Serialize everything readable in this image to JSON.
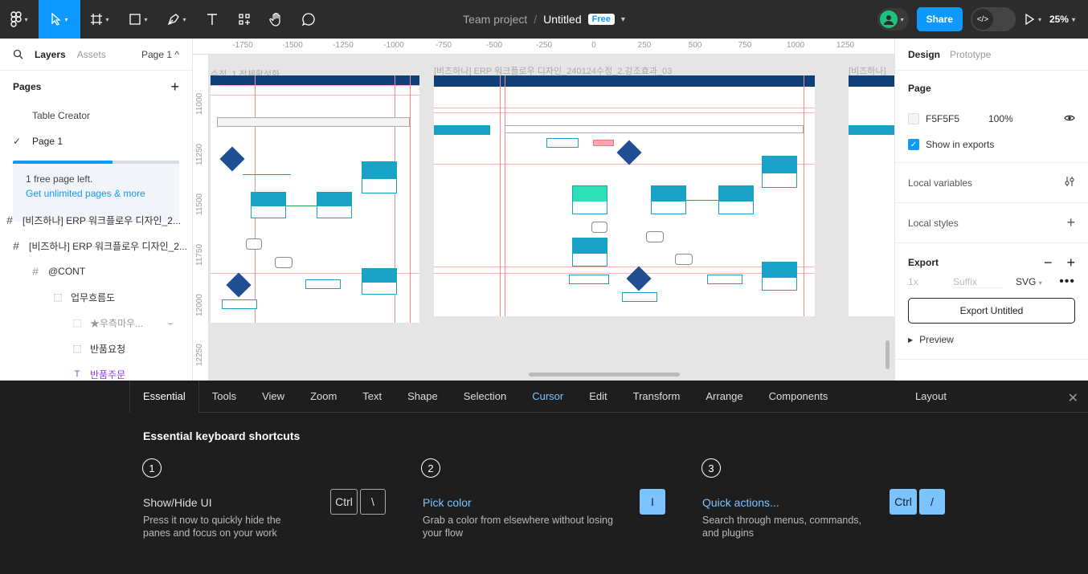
{
  "topbar": {
    "team": "Team project",
    "separator": "/",
    "file": "Untitled",
    "badge": "Free",
    "share": "Share",
    "dev_icon": "</>",
    "zoom": "25%"
  },
  "left": {
    "tab_layers": "Layers",
    "tab_assets": "Assets",
    "page_selector": "Page 1 ^",
    "pages_heading": "Pages",
    "add_icon": "+",
    "pages": [
      "Table Creator",
      "Page 1"
    ],
    "free_notice": "1 free page left.",
    "free_link": "Get unlimited pages & more",
    "layers": [
      {
        "label": "[비즈하나] ERP 워크플로우 디자인_2..."
      },
      {
        "label": "[비즈하나] ERP 워크플로우 디자인_2..."
      },
      {
        "label": "@CONT"
      },
      {
        "label": "업무흐름도"
      },
      {
        "label": "★우측마우..."
      },
      {
        "label": "반품요청"
      },
      {
        "label": "반품주문"
      }
    ]
  },
  "canvas": {
    "ruler_x": [
      "-1750",
      "-1500",
      "-1250",
      "-1000",
      "-750",
      "-500",
      "-250",
      "0",
      "250",
      "500",
      "750",
      "1000",
      "1250"
    ],
    "ruler_y": [
      "11000",
      "11250",
      "11500",
      "11750",
      "12000",
      "12250"
    ],
    "frame_titles": [
      "수정_1.전체활성화",
      "[비즈하나] ERP 워크플로우 디자인_240124수정_2.강조효과_03",
      "[비즈하나]"
    ]
  },
  "right": {
    "tab_design": "Design",
    "tab_prototype": "Prototype",
    "page_heading": "Page",
    "page_color": "F5F5F5",
    "page_opacity": "100%",
    "show_exports": "Show in exports",
    "local_variables": "Local variables",
    "local_styles": "Local styles",
    "export_heading": "Export",
    "export_scale": "1x",
    "export_suffix": "Suffix",
    "export_format": "SVG",
    "export_button": "Export Untitled",
    "preview": "Preview"
  },
  "shortcuts": {
    "tabs": [
      "Essential",
      "Tools",
      "View",
      "Zoom",
      "Text",
      "Shape",
      "Selection",
      "Cursor",
      "Edit",
      "Transform",
      "Arrange",
      "Components"
    ],
    "layout_tab": "Layout",
    "heading": "Essential keyboard shortcuts",
    "items": [
      {
        "num": "1",
        "name": "Show/Hide UI",
        "desc": "Press it now to quickly hide the panes and focus on your work",
        "keys": [
          "Ctrl",
          "\\"
        ]
      },
      {
        "num": "2",
        "name": "Pick color",
        "desc": "Grab a color from elsewhere without losing your flow",
        "keys": [
          "I"
        ]
      },
      {
        "num": "3",
        "name": "Quick actions...",
        "desc": "Search through menus, commands, and plugins",
        "keys": [
          "Ctrl",
          "/"
        ]
      }
    ]
  }
}
